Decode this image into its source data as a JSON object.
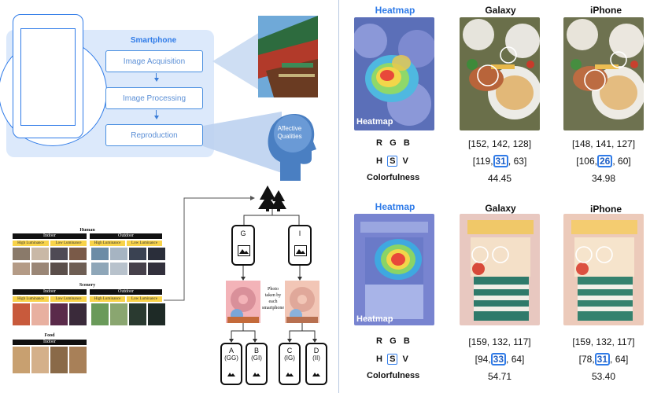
{
  "pipeline": {
    "title": "Smartphone",
    "steps": [
      "Image Acquisition",
      "Image Processing",
      "Reproduction"
    ],
    "head_label": "Affective\nQualities"
  },
  "dataset": {
    "groups": [
      {
        "title": "Human",
        "left_header": "Indoor",
        "right_header": "Outdoor",
        "labels": [
          "High Luminance",
          "Low Luminance",
          "High Luminance",
          "Low Luminance"
        ]
      },
      {
        "title": "Scenery",
        "left_header": "Indoor",
        "right_header": "Outdoor",
        "labels": [
          "High Luminance",
          "Low Luminance",
          "High Luminance",
          "Low Luminance"
        ]
      },
      {
        "title": "Food",
        "left_header": "Indoor",
        "right_header": "",
        "labels": []
      }
    ]
  },
  "tree": {
    "phones": [
      "G",
      "I"
    ],
    "photo_caption": "Photo\ntaken by\neach\nsmartphone",
    "outputs": [
      {
        "letter": "A",
        "code": "(GG)"
      },
      {
        "letter": "B",
        "code": "(GI)"
      },
      {
        "letter": "C",
        "code": "(IG)"
      },
      {
        "letter": "D",
        "code": "(II)"
      }
    ]
  },
  "comparison": [
    {
      "col_headers": [
        "Heatmap",
        "Galaxy",
        "iPhone"
      ],
      "overlay_label": "Heatmap",
      "rgb_letters": [
        "R",
        "G",
        "B"
      ],
      "hsv_letters": [
        "H",
        "S",
        "V"
      ],
      "colorfulness_label": "Colorfulness",
      "galaxy": {
        "rgb": "[152, 142, 128]",
        "hsv_h": "119",
        "hsv_s": "31",
        "hsv_v": "63",
        "colorfulness": "44.45"
      },
      "iphone": {
        "rgb": "[148, 141, 127]",
        "hsv_h": "106",
        "hsv_s": "26",
        "hsv_v": "60",
        "colorfulness": "34.98"
      }
    },
    {
      "col_headers": [
        "Heatmap",
        "Galaxy",
        "iPhone"
      ],
      "overlay_label": "Heatmap",
      "rgb_letters": [
        "R",
        "G",
        "B"
      ],
      "hsv_letters": [
        "H",
        "S",
        "V"
      ],
      "colorfulness_label": "Colorfulness",
      "galaxy": {
        "rgb": "[159, 132, 117]",
        "hsv_h": "94",
        "hsv_s": "33",
        "hsv_v": "64",
        "colorfulness": "54.71"
      },
      "iphone": {
        "rgb": "[159, 132, 117]",
        "hsv_h": "78",
        "hsv_s": "31",
        "hsv_v": "64",
        "colorfulness": "53.40"
      }
    }
  ],
  "colors": {
    "accent": "#2f7be8",
    "panel": "#dce9fb",
    "highlight": "#f8d34a"
  }
}
